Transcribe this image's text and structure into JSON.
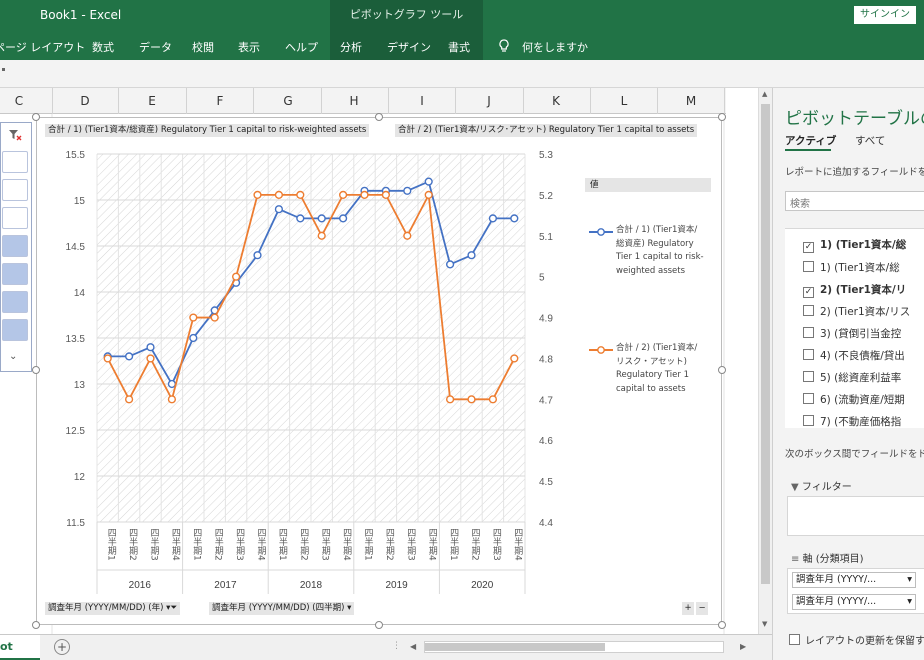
{
  "window": {
    "title": "Book1 - Excel",
    "context_title": "ピボットグラフ ツール",
    "signin_label": "サインイン"
  },
  "ribbon": {
    "tabs": [
      "ページ レイアウト",
      "数式",
      "データ",
      "校閲",
      "表示",
      "ヘルプ",
      "分析",
      "デザイン",
      "書式"
    ],
    "tell_me": "何をしますか"
  },
  "columns": [
    "C",
    "D",
    "E",
    "F",
    "G",
    "H",
    "I",
    "J",
    "K",
    "L",
    "M"
  ],
  "chart": {
    "field_button_1": "合計 / 1) (Tier1資本/総資産) Regulatory Tier 1 capital to risk-weighted assets",
    "field_button_2": "合計 / 2) (Tier1資本/リスク･アセット) Regulatory Tier 1 capital to assets",
    "axis_button_1": "調査年月 (YYYY/MM/DD) (年)",
    "axis_button_2": "調査年月 (YYYY/MM/DD) (四半期)",
    "legend_title": "値",
    "legend_1": [
      "合計 / 1) (Tier1資本/",
      "総資産) Regulatory",
      "Tier 1 capital to risk-",
      "weighted assets"
    ],
    "legend_2": [
      "合計 / 2) (Tier1資本/",
      "リスク・アセット)",
      "Regulatory Tier 1",
      "capital to assets"
    ],
    "zoom_buttons": [
      "+",
      "−"
    ]
  },
  "chart_data": {
    "type": "line",
    "categories": [
      "四半期1",
      "四半期2",
      "四半期3",
      "四半期4",
      "四半期1",
      "四半期2",
      "四半期3",
      "四半期4",
      "四半期1",
      "四半期2",
      "四半期3",
      "四半期4",
      "四半期1",
      "四半期2",
      "四半期3",
      "四半期4",
      "四半期1",
      "四半期2",
      "四半期3",
      "四半期4"
    ],
    "years": [
      "2016",
      "2017",
      "2018",
      "2019",
      "2020"
    ],
    "series": [
      {
        "name": "合計 / 1) (Tier1資本/総資産) Regulatory Tier 1 capital to risk-weighted assets",
        "axis": "left",
        "color": "#4472c4",
        "values": [
          13.3,
          13.3,
          13.4,
          13.0,
          13.5,
          13.8,
          14.1,
          14.4,
          14.9,
          14.8,
          14.8,
          14.8,
          15.1,
          15.1,
          15.1,
          15.2,
          14.3,
          14.4,
          14.8,
          14.8
        ]
      },
      {
        "name": "合計 / 2) (Tier1資本/リスク・アセット) Regulatory Tier 1 capital to assets",
        "axis": "right",
        "color": "#ed7d31",
        "values": [
          4.8,
          4.7,
          4.8,
          4.7,
          4.9,
          4.9,
          5.0,
          5.2,
          5.2,
          5.2,
          5.1,
          5.2,
          5.2,
          5.2,
          5.1,
          5.2,
          4.7,
          4.7,
          4.7,
          4.8
        ]
      }
    ],
    "y_left": {
      "ticks": [
        "15.5",
        "15",
        "14.5",
        "14",
        "13.5",
        "13",
        "12.5",
        "12",
        "11.5"
      ],
      "range": [
        11.5,
        15.5
      ]
    },
    "y_right": {
      "ticks": [
        "5.3",
        "5.2",
        "5.1",
        "5",
        "4.9",
        "4.8",
        "4.7",
        "4.6",
        "4.5",
        "4.4"
      ],
      "range": [
        4.4,
        5.3
      ]
    },
    "grid": true,
    "legend_position": "right"
  },
  "pane": {
    "title": "ピボットテーブルのフ",
    "tab_active": "アクティブ",
    "tab_all": "すべて",
    "hint": "レポートに追加するフィールドを選",
    "search_placeholder": "検索",
    "fields": [
      {
        "label": "1) (Tier1資本/総",
        "checked": true,
        "bold": true
      },
      {
        "label": "1) (Tier1資本/総",
        "checked": false,
        "bold": false
      },
      {
        "label": "2) (Tier1資本/リ",
        "checked": true,
        "bold": true
      },
      {
        "label": "2) (Tier1資本/リス",
        "checked": false,
        "bold": false
      },
      {
        "label": "3) (貸倒引当金控",
        "checked": false,
        "bold": false
      },
      {
        "label": "4) (不良債権/貸出",
        "checked": false,
        "bold": false
      },
      {
        "label": "5) (総資産利益率",
        "checked": false,
        "bold": false
      },
      {
        "label": "6) (流動資産/短期",
        "checked": false,
        "bold": false
      },
      {
        "label": "7) (不動産価格指",
        "checked": false,
        "bold": false
      }
    ],
    "drag_hint": "次のボックス間でフィールドをドラ",
    "filter_label": "フィルター",
    "axis_label": "軸 (分類項目)",
    "axis_items": [
      "調査年月 (YYYY/...",
      "調査年月 (YYYY/..."
    ],
    "defer_label": "レイアウトの更新を保留する"
  },
  "sheet": {
    "tab_label": "ot",
    "add_sheet": "+"
  }
}
